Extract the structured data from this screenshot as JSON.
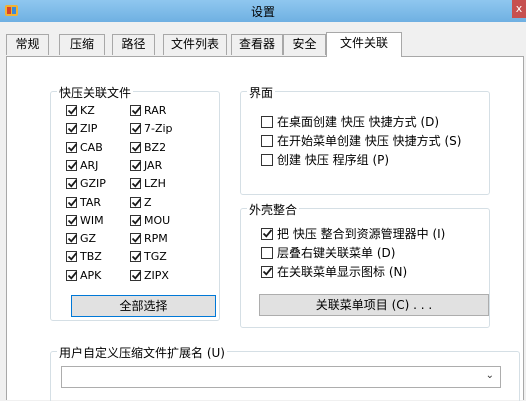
{
  "window": {
    "title": "设置",
    "close_label": "x"
  },
  "tabs": [
    {
      "label": "常规"
    },
    {
      "label": "压缩"
    },
    {
      "label": "路径"
    },
    {
      "label": "文件列表"
    },
    {
      "label": "查看器"
    },
    {
      "label": "安全"
    },
    {
      "label": "文件关联",
      "active": true
    }
  ],
  "associations": {
    "title": "快压关联文件",
    "left_column": [
      {
        "label": "KZ",
        "checked": true
      },
      {
        "label": "ZIP",
        "checked": true
      },
      {
        "label": "CAB",
        "checked": true
      },
      {
        "label": "ARJ",
        "checked": true
      },
      {
        "label": "GZIP",
        "checked": true
      },
      {
        "label": "TAR",
        "checked": true
      },
      {
        "label": "WIM",
        "checked": true
      },
      {
        "label": "GZ",
        "checked": true
      },
      {
        "label": "TBZ",
        "checked": true
      },
      {
        "label": "APK",
        "checked": true
      }
    ],
    "right_column": [
      {
        "label": "RAR",
        "checked": true
      },
      {
        "label": "7-Zip",
        "checked": true
      },
      {
        "label": "BZ2",
        "checked": true
      },
      {
        "label": "JAR",
        "checked": true
      },
      {
        "label": "LZH",
        "checked": true
      },
      {
        "label": "Z",
        "checked": true
      },
      {
        "label": "MOU",
        "checked": true
      },
      {
        "label": "RPM",
        "checked": true
      },
      {
        "label": "TGZ",
        "checked": true
      },
      {
        "label": "ZIPX",
        "checked": true
      }
    ],
    "select_all_label": "全部选择"
  },
  "interface": {
    "title": "界面",
    "options": [
      {
        "label": "在桌面创建 快压 快捷方式 (D)",
        "checked": false
      },
      {
        "label": "在开始菜单创建 快压 快捷方式 (S)",
        "checked": false
      },
      {
        "label": "创建 快压 程序组 (P)",
        "checked": false
      }
    ]
  },
  "shell": {
    "title": "外壳整合",
    "options": [
      {
        "label": "把 快压 整合到资源管理器中 (I)",
        "checked": true
      },
      {
        "label": "层叠右键关联菜单 (D)",
        "checked": false
      },
      {
        "label": "在关联菜单显示图标 (N)",
        "checked": true
      }
    ],
    "menu_items_label": "关联菜单项目 (C) . . ."
  },
  "custom_ext": {
    "title": "用户自定义压缩文件扩展名 (U)",
    "value": ""
  },
  "colors": {
    "titlebar": "#7dbbe9",
    "accent": "#0078d7",
    "close": "#c75050"
  }
}
